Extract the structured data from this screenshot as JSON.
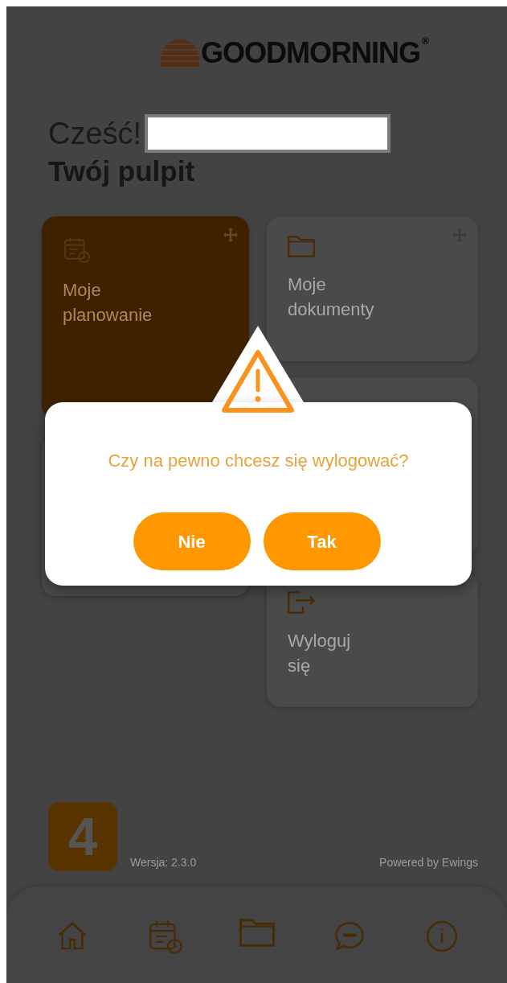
{
  "header": {
    "logo_text": "GOODMORNING",
    "registered_mark": "®"
  },
  "greeting": "Cześć!",
  "title": "Twój pulpit",
  "tiles": [
    {
      "label": "Moje planowanie",
      "kind": "planning",
      "highlighted": true,
      "movable": true
    },
    {
      "label": "Moje dokumenty",
      "kind": "documents",
      "highlighted": false,
      "movable": true
    },
    {
      "label": "Wyloguj się",
      "kind": "logout",
      "highlighted": false
    }
  ],
  "dialog": {
    "message": "Czy na pewno chcesz się wylogować?",
    "buttons": [
      "Nie",
      "Tak"
    ]
  },
  "footer": {
    "badge": "4",
    "version": "Wersja: 2.3.0",
    "powered_by": "Powered by Ewings"
  },
  "bottom_nav": [
    {
      "kind": "home"
    },
    {
      "kind": "planning"
    },
    {
      "kind": "documents"
    },
    {
      "kind": "chat"
    },
    {
      "kind": "info"
    }
  ]
}
